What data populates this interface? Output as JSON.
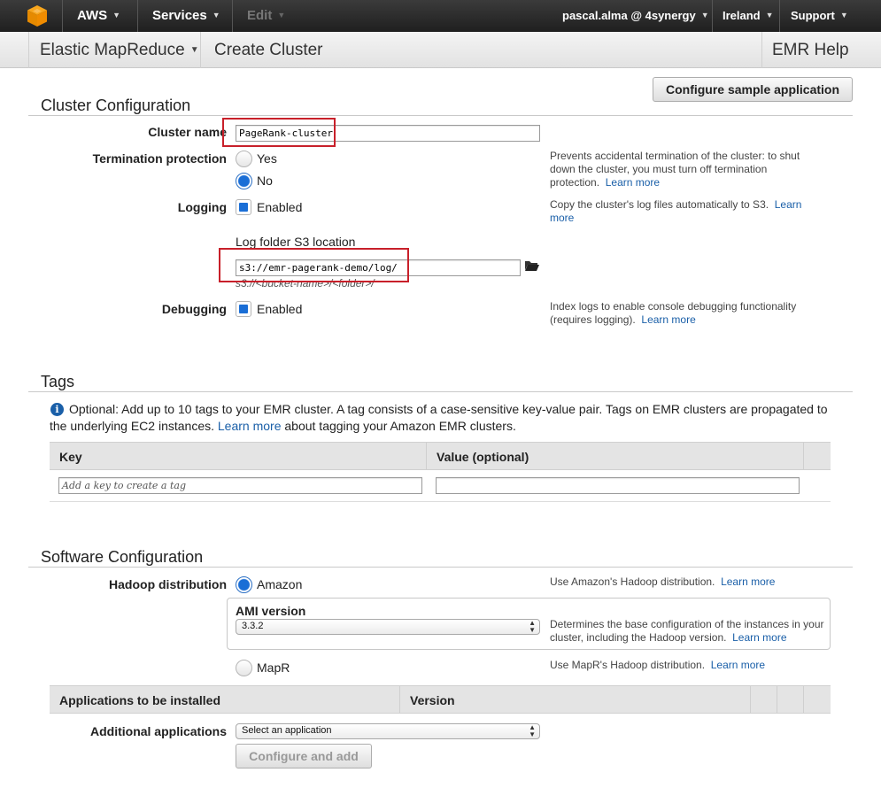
{
  "topnav": {
    "brand": "AWS",
    "services": "Services",
    "edit": "Edit",
    "account": "pascal.alma @ 4synergy",
    "region": "Ireland",
    "support": "Support"
  },
  "subheader": {
    "service": "Elastic MapReduce",
    "page": "Create Cluster",
    "help": "EMR Help"
  },
  "sample_button": "Configure sample application",
  "cluster_config": {
    "title": "Cluster Configuration",
    "cluster_name_label": "Cluster name",
    "cluster_name_value": "PageRank-cluster",
    "termination_label": "Termination protection",
    "termination_yes": "Yes",
    "termination_no": "No",
    "termination_help": "Prevents accidental termination of the cluster: to shut down the cluster, you must turn off termination protection.",
    "termination_help_link": "Learn more",
    "logging_label": "Logging",
    "logging_enabled": "Enabled",
    "logging_help": "Copy the cluster's log files automatically to S3.",
    "logging_help_link": "Learn more",
    "log_folder_label": "Log folder S3 location",
    "log_folder_value": "s3://emr-pagerank-demo/log/",
    "log_folder_hint": "s3://<bucket-name>/<folder>/",
    "debugging_label": "Debugging",
    "debugging_enabled": "Enabled",
    "debugging_help": "Index logs to enable console debugging functionality (requires logging).",
    "debugging_help_link": "Learn more"
  },
  "tags": {
    "title": "Tags",
    "info": "Optional: Add up to 10 tags to your EMR cluster. A tag consists of a case-sensitive key-value pair. Tags on EMR clusters are propagated to the underlying EC2 instances.",
    "info_link": "Learn more",
    "info_tail": "about tagging your Amazon EMR clusters.",
    "col_key": "Key",
    "col_value": "Value (optional)",
    "key_placeholder": "Add a key to create a tag",
    "value_placeholder": ""
  },
  "software": {
    "title": "Software Configuration",
    "hadoop_label": "Hadoop distribution",
    "amazon": "Amazon",
    "amazon_help": "Use Amazon's Hadoop distribution.",
    "amazon_help_link": "Learn more",
    "ami_label": "AMI version",
    "ami_value": "3.3.2",
    "ami_help": "Determines the base configuration of the instances in your cluster, including the Hadoop version.",
    "ami_help_link": "Learn more",
    "mapr": "MapR",
    "mapr_help": "Use MapR's Hadoop distribution.",
    "mapr_help_link": "Learn more",
    "col_apps": "Applications to be installed",
    "col_version": "Version",
    "additional_label": "Additional applications",
    "additional_select": "Select an application",
    "configure_add": "Configure and add"
  }
}
